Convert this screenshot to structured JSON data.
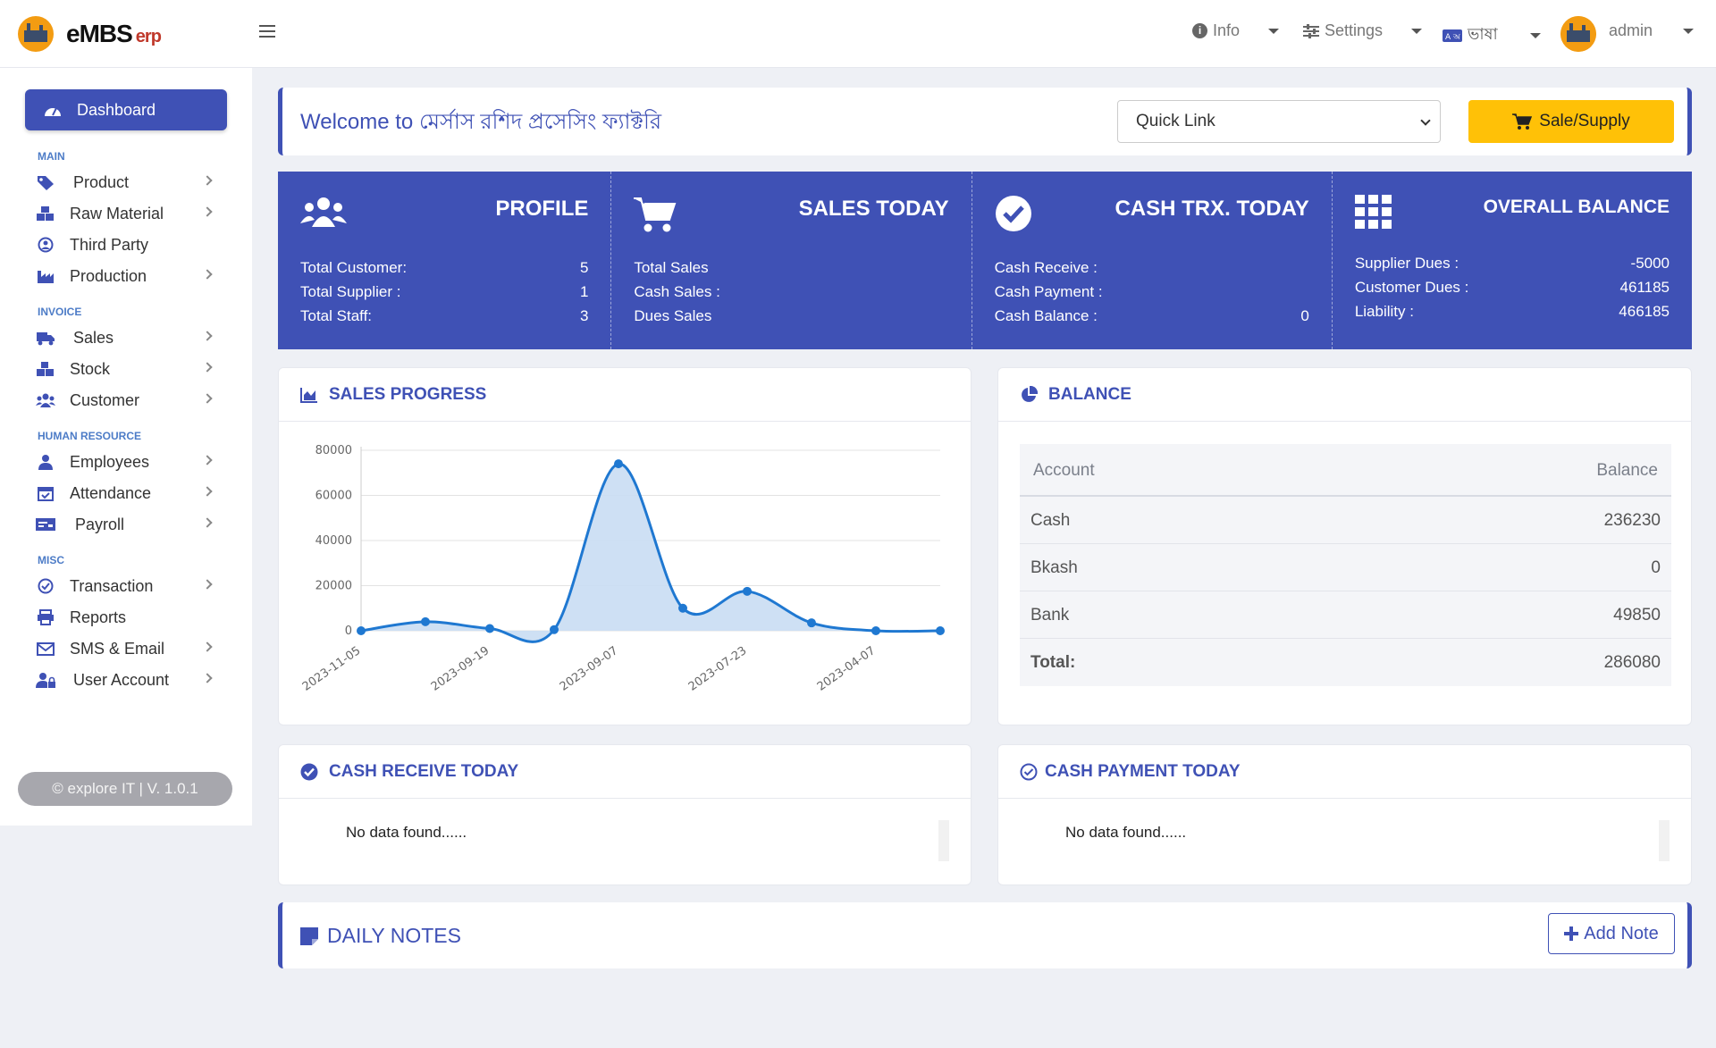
{
  "app": {
    "logo_text": "eMBS",
    "logo_suffix": "erp"
  },
  "topbar": {
    "info_label": "Info",
    "settings_label": "Settings",
    "language_label": "ভাষা",
    "user_label": "admin"
  },
  "sidebar": {
    "dashboard_label": "Dashboard",
    "sections": {
      "main": "MAIN",
      "invoice": "INVOICE",
      "human_resource": "HUMAN RESOURCE",
      "misc": "MISC"
    },
    "items": {
      "product": "Product",
      "raw_material": "Raw Material",
      "third_party": "Third Party",
      "production": "Production",
      "sales": "Sales",
      "stock": "Stock",
      "customer": "Customer",
      "employees": "Employees",
      "attendance": "Attendance",
      "payroll": "Payroll",
      "transaction": "Transaction",
      "reports": "Reports",
      "sms_email": "SMS & Email",
      "user_account": "User Account"
    },
    "footer": "© explore IT | V. 1.0.1"
  },
  "welcome": {
    "title": "Welcome to মের্সাস রশিদ প্রসেসিং ফ্যাক্টরি",
    "quick_link": "Quick Link",
    "sale_button": "Sale/Supply"
  },
  "stats": {
    "profile": {
      "title": "PROFILE",
      "rows": [
        {
          "label": "Total Customer:",
          "value": "5"
        },
        {
          "label": "Total Supplier :",
          "value": "1"
        },
        {
          "label": "Total Staff:",
          "value": "3"
        }
      ]
    },
    "sales_today": {
      "title": "SALES TODAY",
      "rows": [
        {
          "label": "Total Sales",
          "value": ""
        },
        {
          "label": "Cash Sales :",
          "value": ""
        },
        {
          "label": "Dues Sales",
          "value": ""
        }
      ]
    },
    "cash_trx": {
      "title": "CASH TRX. TODAY",
      "rows": [
        {
          "label": "Cash Receive :",
          "value": ""
        },
        {
          "label": "Cash Payment :",
          "value": ""
        },
        {
          "label": "Cash Balance :",
          "value": "0"
        }
      ]
    },
    "overall": {
      "title": "OVERALL BALANCE",
      "rows": [
        {
          "label": "Supplier Dues :",
          "value": "-5000"
        },
        {
          "label": "Customer Dues :",
          "value": "461185"
        },
        {
          "label": "Liability :",
          "value": "466185"
        }
      ]
    }
  },
  "sales_progress": {
    "title": "SALES PROGRESS"
  },
  "chart_data": {
    "type": "area",
    "x": [
      "2023-11-05",
      "",
      "2023-09-19",
      "",
      "2023-09-07",
      "",
      "2023-07-23",
      "",
      "2023-04-07",
      ""
    ],
    "tick_labels": [
      "2023-11-05",
      "2023-09-19",
      "2023-09-07",
      "2023-07-23",
      "2023-04-07"
    ],
    "series": [
      {
        "values": [
          0,
          4000,
          1000,
          500,
          74000,
          10000,
          17500,
          3500,
          0,
          0
        ]
      }
    ],
    "yticks": [
      0,
      20000,
      40000,
      60000,
      80000
    ],
    "ylim": [
      0,
      80000
    ],
    "grid": true,
    "color": "#1f78d1",
    "fill": "#c9ddf3"
  },
  "balance": {
    "title": "BALANCE",
    "header": {
      "account": "Account",
      "balance": "Balance"
    },
    "rows": [
      {
        "account": "Cash",
        "balance": "236230"
      },
      {
        "account": "Bkash",
        "balance": "0"
      },
      {
        "account": "Bank",
        "balance": "49850"
      }
    ],
    "total_label": "Total:",
    "total_value": "286080"
  },
  "cash_receive": {
    "title": "CASH RECEIVE TODAY",
    "empty": "No data found......"
  },
  "cash_payment": {
    "title": "CASH PAYMENT TODAY",
    "empty": "No data found......"
  },
  "notes": {
    "title": "DAILY NOTES",
    "add_button": "Add Note"
  },
  "colors": {
    "primary": "#3f51b5",
    "accent": "#ffc107",
    "background": "#eef0f5"
  }
}
